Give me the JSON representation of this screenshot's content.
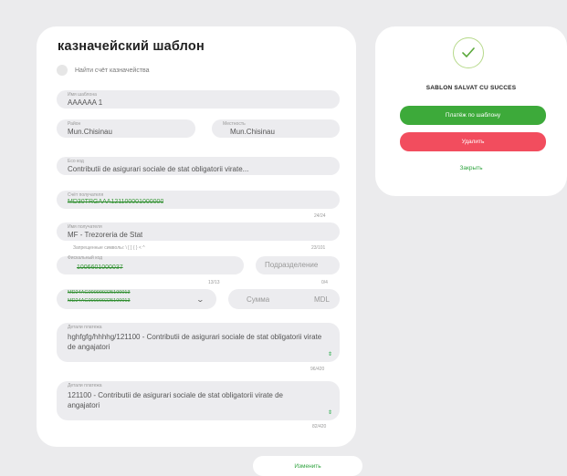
{
  "form": {
    "title": "казначейский шаблон",
    "find_account_label": "Найти счёт казначейства",
    "template_name": {
      "label": "Имя шаблона",
      "value": "AAAAAA 1"
    },
    "district": {
      "label": "Район",
      "value": "Mun.Chisinau"
    },
    "locality": {
      "label": "Местность",
      "value": "Mun.Chisinau"
    },
    "eco_code": {
      "label": "Eco код",
      "value": "Contributii de asigurari sociale de stat obligatorii virate..."
    },
    "recipient_account": {
      "label": "Счёт получателя",
      "value": "MD30TRGAAA121100001000000",
      "counter": "24/24"
    },
    "recipient_name": {
      "label": "Имя получателя",
      "value": "MF - Trezoreria de Stat",
      "counter": "23/101"
    },
    "forbidden_hint": "Запрещенные символы: \\ [ ] { } < ^",
    "fiscal_code": {
      "label": "Фискальный код",
      "value": "1006601000037",
      "counter": "13/13"
    },
    "subdivision": {
      "placeholder": "Подразделение",
      "counter": "0/4"
    },
    "account_select": {
      "line1": "MD24AG000000225100013",
      "line2": "MD24AG000000225100013"
    },
    "amount": {
      "placeholder": "Сумма",
      "currency": "MDL"
    },
    "details1": {
      "label": "Детали платежа",
      "value": "hghfgfg/hhhhg/121100 - Contributii de asigurari sociale de stat obligatorii virate de angajatori",
      "counter": "96/420"
    },
    "details2": {
      "label": "Детали платежа",
      "value": "121100 - Contributii de asigurari sociale de stat obligatorii virate de angajatori",
      "counter": "82/420"
    },
    "edit_button": "Изменить"
  },
  "modal": {
    "title": "SABLON SALVAT CU SUCCES",
    "pay_button": "Платёж по шаблону",
    "delete_button": "Удалить",
    "close_link": "Закрыть",
    "colors": {
      "pay": "#3daa3a",
      "delete": "#f24d5e",
      "accent": "#2ea33e"
    }
  }
}
